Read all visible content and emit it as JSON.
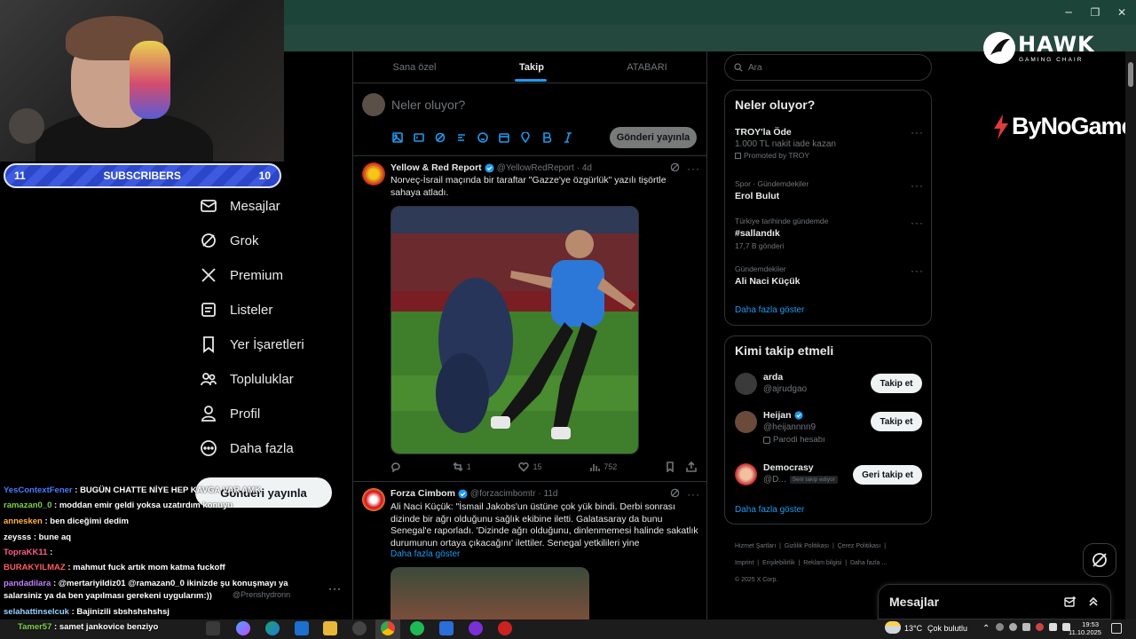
{
  "browser": {
    "controls": {
      "minimize": "─",
      "restore": "❐",
      "close": "✕"
    }
  },
  "overlay": {
    "subscribers": {
      "left_count": "11",
      "label": "SUBSCRIBERS",
      "right_count": "10"
    },
    "sponsor_logo": {
      "name": "HAWK",
      "sub": "GAMING CHAIR"
    },
    "sponsor_logo2": "ByNoGame"
  },
  "nav": {
    "items": [
      {
        "label": "Mesajlar",
        "icon": "mail-icon"
      },
      {
        "label": "Grok",
        "icon": "grok-icon"
      },
      {
        "label": "Premium",
        "icon": "x-logo-icon"
      },
      {
        "label": "Listeler",
        "icon": "list-icon"
      },
      {
        "label": "Yer İşaretleri",
        "icon": "bookmark-icon"
      },
      {
        "label": "Topluluklar",
        "icon": "communities-icon"
      },
      {
        "label": "Profil",
        "icon": "profile-icon"
      },
      {
        "label": "Daha fazla",
        "icon": "more-circle-icon"
      }
    ],
    "post_button": "Gönderi yayınla"
  },
  "feed": {
    "tabs": [
      "Sana özel",
      "Takip",
      "ATABARI"
    ],
    "active_tab": 1,
    "composer": {
      "placeholder": "Neler oluyor?",
      "post_button": "Gönderi yayınla"
    },
    "tweets": [
      {
        "author": "Yellow & Red Report",
        "handle": "@YellowRedReport",
        "time": "· 4d",
        "text": "Norveç-İsrail maçında bir taraftar \"Gazze'ye özgürlük\" yazılı tişörtle sahaya atladı.",
        "replies": "",
        "reposts": "1",
        "likes": "15",
        "views": "752"
      },
      {
        "author": "Forza Cimbom",
        "handle": "@forzacimbomtr",
        "time": "· 11d",
        "text": "Ali Naci Küçük: \"İsmail Jakobs'un üstüne çok yük bindi. Derbi sonrası dizinde bir ağrı olduğunu sağlık ekibine iletti. Galatasaray da bunu Senegal'e raporladı. 'Dizinde ağrı olduğunu, dinlenmemesi halinde sakatlık durumunun ortaya çıkacağını' ilettiler. Senegal yetkilileri yine",
        "show_more": "Daha fazla göster"
      }
    ]
  },
  "sidebar": {
    "search_placeholder": "Ara",
    "trends_title": "Neler oluyor?",
    "trends": [
      {
        "sub": "",
        "main": "TROY'la Öde",
        "detail": "1.000 TL nakit iade kazan",
        "promoted": "Promoted by TROY"
      },
      {
        "sub": "Spor · Gündemdekiler",
        "main": "Erol Bulut",
        "detail": ""
      },
      {
        "sub": "Türkiye tarihinde gündemde",
        "main": "#sallandık",
        "detail": "17,7 B gönderi"
      },
      {
        "sub": "Gündemdekiler",
        "main": "Ali Naci Küçük",
        "detail": ""
      }
    ],
    "trends_more": "Daha fazla göster",
    "who_to_follow_title": "Kimi takip etmeli",
    "suggestions": [
      {
        "name": "arda",
        "handle": "@ajrudgao",
        "button": "Takip et",
        "note": ""
      },
      {
        "name": "Heijan",
        "handle": "@heijannnn9",
        "button": "Takip et",
        "note": "Parodi hesabı"
      },
      {
        "name": "Democrasy",
        "handle": "@D...",
        "button": "Geri takip et",
        "note": "Seni takip ediyor"
      }
    ],
    "follow_more": "Daha fazla göster",
    "footer": [
      "Hizmet Şartları",
      "Gizlilik Politikası",
      "Çerez Politikası",
      "Imprint",
      "Erişilebilirlik",
      "Reklam bilgisi",
      "Daha fazla ...",
      "© 2025 X Corp."
    ],
    "messages_drawer": "Mesajlar"
  },
  "chat": [
    {
      "user": "YesContextFener",
      "color": "#4a7bff",
      "msg": ": BUGÜN CHATTE NİYE HEP KAVGA VAR AMK"
    },
    {
      "user": "ramazan0_0",
      "color": "#7fd14a",
      "msg": ": moddan emir geldi yoksa uzatırdım konuyu"
    },
    {
      "user": "annesken",
      "color": "#ffb347",
      "msg": ": ben diceğimi dedim"
    },
    {
      "user": "zeysss",
      "color": "#ffffff",
      "msg": ": bune aq"
    },
    {
      "user": "TopraKK11",
      "color": "#ff5c8a",
      "msg": ":"
    },
    {
      "user": "BURAKYILMAZ",
      "color": "#ff5c5c",
      "msg": ": mahmut fuck artık mom katma fuckoff"
    },
    {
      "user": "pandadilara",
      "color": "#c080ff",
      "msg": ": @mertariyildiz01 @ramazan0_0 ikinizde şu konuşmayı ya"
    },
    {
      "user": "",
      "color": "#ffffff",
      "msg": "salarsiniz ya da ben yapılması gerekeni uygularım:))"
    },
    {
      "user": "selahattinselcuk",
      "color": "#9ad0ff",
      "msg": ": Bajinizili sbshshshshsj"
    },
    {
      "user": "Tamer57",
      "color": "#7fd14a",
      "msg": ": samet jankovice benziyo"
    }
  ],
  "ghost_handle": "@Prenshydronn",
  "taskbar": {
    "weather_temp": "13°C",
    "weather_text": "Çok bulutlu",
    "time": "19:53",
    "date": "11.10.2025"
  }
}
